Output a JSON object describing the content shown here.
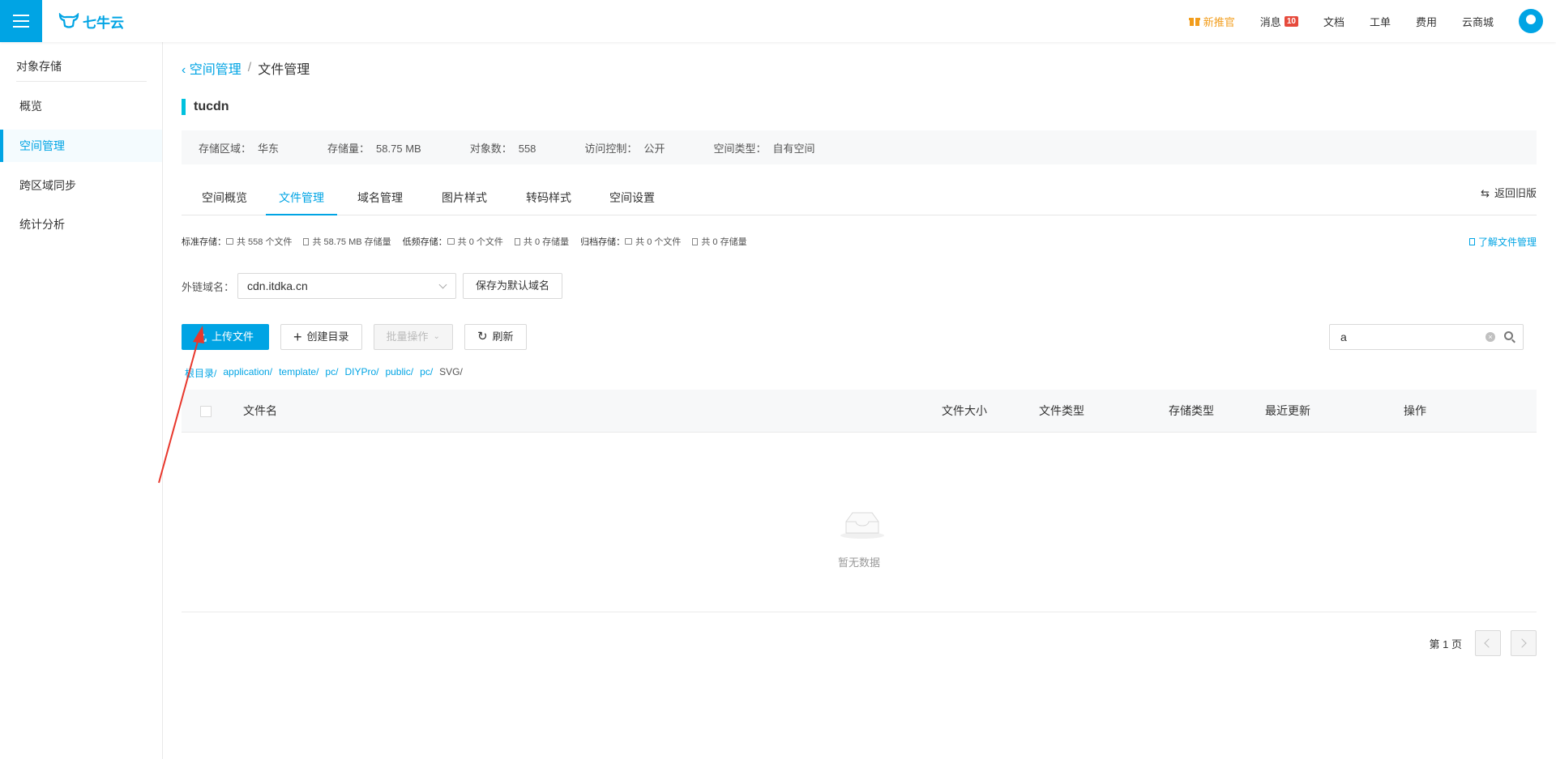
{
  "header": {
    "logo_text": "七牛云",
    "nav": {
      "promo": "新推官",
      "messages": "消息",
      "messages_count": "10",
      "docs": "文档",
      "tickets": "工单",
      "billing": "费用",
      "market": "云商城"
    }
  },
  "sidebar": {
    "title": "对象存储",
    "items": [
      {
        "label": "概览"
      },
      {
        "label": "空间管理"
      },
      {
        "label": "跨区域同步"
      },
      {
        "label": "统计分析"
      }
    ]
  },
  "breadcrumb": {
    "back": "空间管理",
    "separator": "/",
    "current": "文件管理"
  },
  "bucket": {
    "name": "tucdn",
    "info": {
      "region_label": "存储区域：",
      "region": "华东",
      "size_label": "存储量：",
      "size": "58.75 MB",
      "objects_label": "对象数：",
      "objects": "558",
      "acl_label": "访问控制：",
      "acl": "公开",
      "type_label": "空间类型：",
      "type": "自有空间"
    }
  },
  "tabs": [
    {
      "label": "空间概览"
    },
    {
      "label": "文件管理"
    },
    {
      "label": "域名管理"
    },
    {
      "label": "图片样式"
    },
    {
      "label": "转码样式"
    },
    {
      "label": "空间设置"
    }
  ],
  "old_version": "返回旧版",
  "storage": {
    "standard_label": "标准存储：",
    "standard_files": "共 558 个文件",
    "standard_size": "共 58.75 MB 存储量",
    "low_label": "低频存储：",
    "low_files": "共 0 个文件",
    "low_size": "共 0 存储量",
    "archive_label": "归档存储：",
    "archive_files": "共 0 个文件",
    "archive_size": "共 0 存储量"
  },
  "learn_link": "了解文件管理",
  "domain": {
    "label": "外链域名：",
    "value": "cdn.itdka.cn",
    "save_button": "保存为默认域名"
  },
  "actions": {
    "upload": "上传文件",
    "mkdir": "创建目录",
    "batch": "批量操作",
    "refresh": "刷新"
  },
  "search": {
    "value": "a"
  },
  "path": [
    "根目录/",
    "application/",
    "template/",
    "pc/",
    "DIYPro/",
    "public/",
    "pc/",
    "SVG/"
  ],
  "table": {
    "columns": [
      "文件名",
      "文件大小",
      "文件类型",
      "存储类型",
      "最近更新",
      "操作"
    ],
    "empty_text": "暂无数据"
  },
  "pager": {
    "label": "第 1 页"
  },
  "colors": {
    "accent": "#00a4e4",
    "promo": "#f29d1c",
    "badge": "#e64a3c",
    "annotation_arrow": "#e8372c"
  }
}
